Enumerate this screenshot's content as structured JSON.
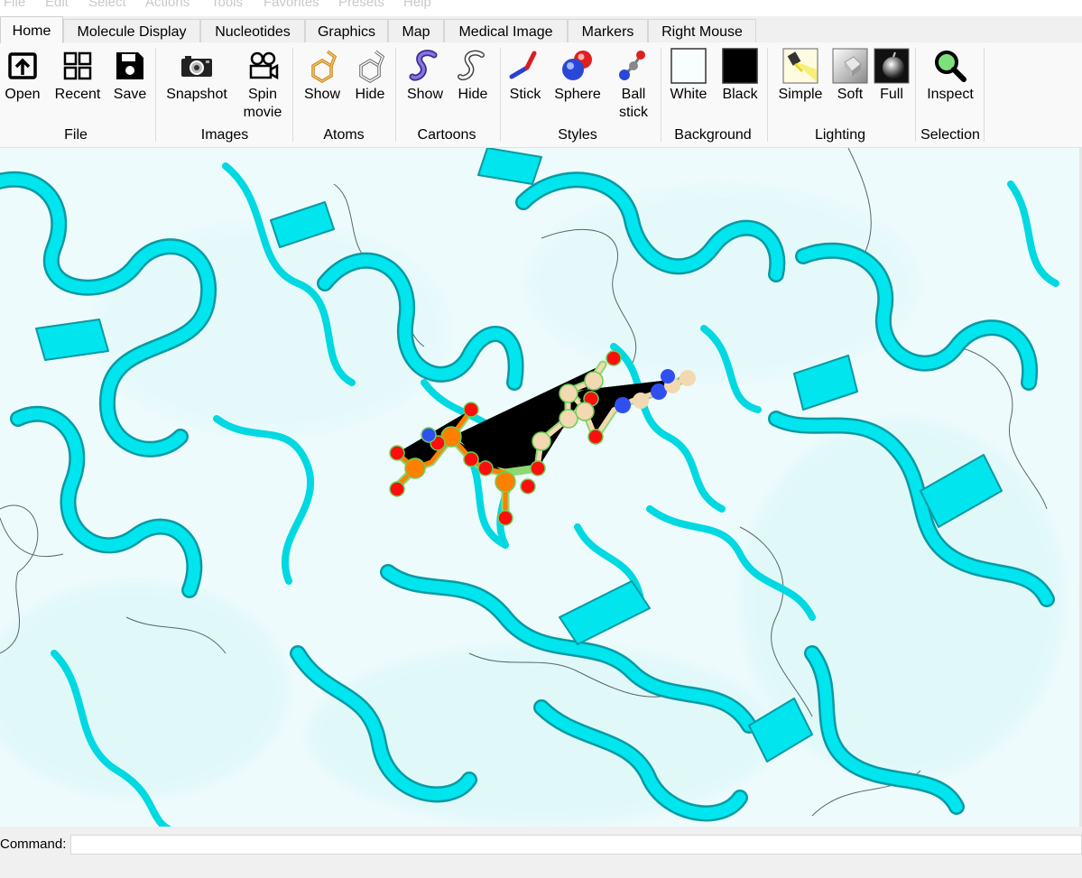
{
  "menubar": {
    "items": [
      "File",
      "Edit",
      "Select",
      "Actions",
      "Tools",
      "Favorites",
      "Presets",
      "Help"
    ]
  },
  "tabs": [
    "Home",
    "Molecule Display",
    "Nucleotides",
    "Graphics",
    "Map",
    "Medical Image",
    "Markers",
    "Right Mouse"
  ],
  "active_tab": "Home",
  "groups": {
    "file": {
      "label": "File",
      "tools": {
        "open": "Open",
        "recent": "Recent",
        "save": "Save"
      }
    },
    "images": {
      "label": "Images",
      "tools": {
        "snapshot": "Snapshot",
        "spin1": "Spin",
        "spin2": "movie"
      }
    },
    "atoms": {
      "label": "Atoms",
      "tools": {
        "show": "Show",
        "hide": "Hide"
      }
    },
    "cartoons": {
      "label": "Cartoons",
      "tools": {
        "show": "Show",
        "hide": "Hide"
      }
    },
    "styles": {
      "label": "Styles",
      "tools": {
        "stick": "Stick",
        "sphere": "Sphere",
        "ball1": "Ball",
        "ball2": "stick"
      }
    },
    "background": {
      "label": "Background",
      "tools": {
        "white": "White",
        "black": "Black"
      }
    },
    "lighting": {
      "label": "Lighting",
      "tools": {
        "simple": "Simple",
        "soft": "Soft",
        "full": "Full"
      }
    },
    "selection": {
      "label": "Selection",
      "tools": {
        "inspect": "Inspect"
      }
    }
  },
  "command": {
    "label": "Command:",
    "value": ""
  },
  "colors": {
    "protein_cartoon": "#00e5ee",
    "surface": "#eefbfc",
    "ligand_carbon": "#f3d9b1",
    "oxygen": "#ff0d0d",
    "nitrogen": "#2f4ff0",
    "phosphorus": "#ff8000"
  },
  "icons": [
    "open-icon",
    "recent-icon",
    "save-icon",
    "snapshot-icon",
    "spin-movie-icon",
    "show-atoms-icon",
    "hide-atoms-icon",
    "show-cartoons-icon",
    "hide-cartoons-icon",
    "stick-icon",
    "sphere-icon",
    "ball-stick-icon",
    "white-background-icon",
    "black-background-icon",
    "simple-lighting-icon",
    "soft-lighting-icon",
    "full-lighting-icon",
    "inspect-icon"
  ]
}
